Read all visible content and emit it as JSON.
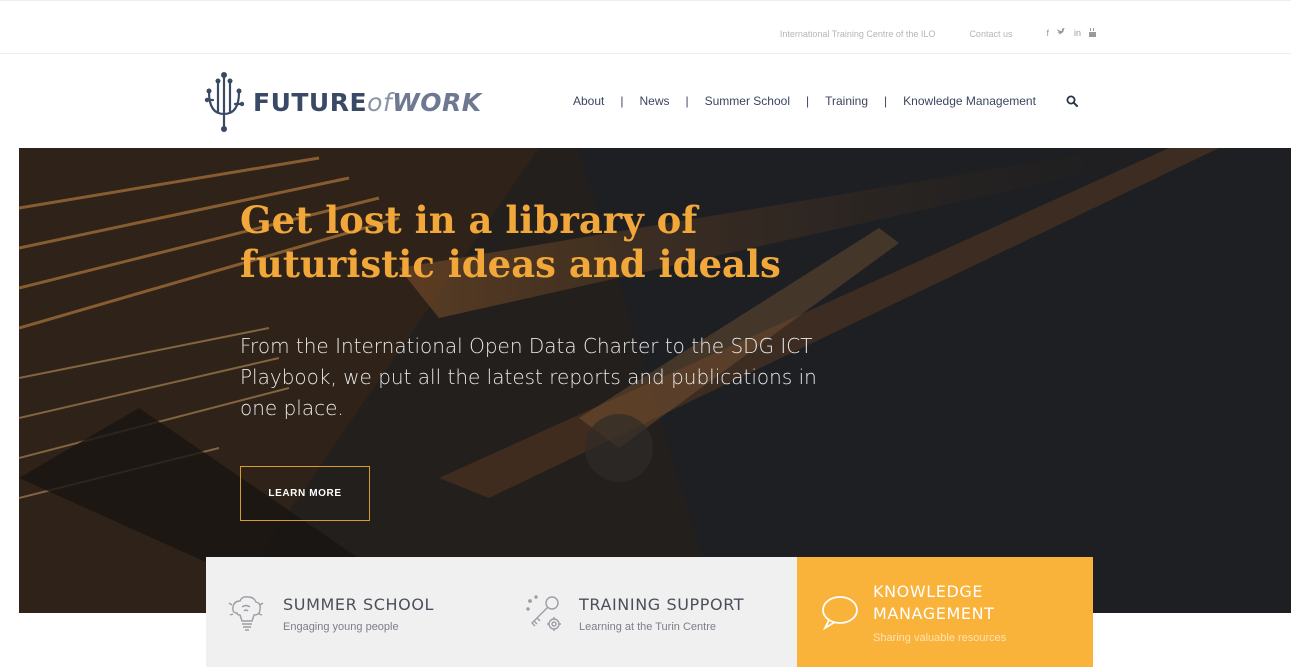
{
  "topbar": {
    "org_link": "International Training Centre of the ILO",
    "contact_link": "Contact us",
    "social": {
      "facebook": "f",
      "twitter": "𝕥",
      "linkedin": "in",
      "youtube": "▣"
    }
  },
  "logo": {
    "word_future": "FUTURE",
    "word_of": "of",
    "word_work": "WORK"
  },
  "nav": {
    "items": [
      "About",
      "News",
      "Summer School",
      "Training",
      "Knowledge Management"
    ],
    "separator": "|"
  },
  "hero": {
    "title": "Get lost in a library of futuristic ideas and ideals",
    "text": "From the International Open Data Charter to the SDG ICT Playbook, we put all the latest reports and publications in one place.",
    "button": "LEARN MORE"
  },
  "cards": [
    {
      "title": "SUMMER SCHOOL",
      "subtitle": "Engaging young people",
      "icon": "brain-lightbulb-icon"
    },
    {
      "title": "TRAINING SUPPORT",
      "subtitle": "Learning at the Turin Centre",
      "icon": "key-gear-icon"
    },
    {
      "title": "KNOWLEDGE MANAGEMENT",
      "subtitle": "Sharing valuable resources",
      "icon": "speech-bubble-icon"
    }
  ],
  "colors": {
    "accent": "#f1a73a",
    "card_active": "#f9b23a",
    "navy": "#3a4a66"
  }
}
